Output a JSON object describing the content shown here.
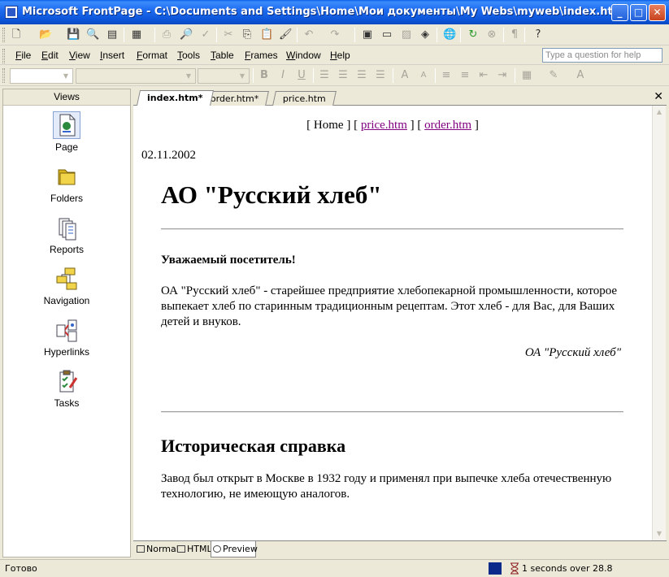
{
  "window": {
    "title": "Microsoft FrontPage - C:\\Documents and Settings\\Home\\Мои документы\\My Webs\\myweb\\index.htm",
    "minimize": "_",
    "maximize": "□",
    "close": "✕"
  },
  "menu": {
    "items": [
      {
        "key": "F",
        "rest": "ile"
      },
      {
        "key": "E",
        "rest": "dit"
      },
      {
        "key": "V",
        "rest": "iew"
      },
      {
        "key": "I",
        "rest": "nsert"
      },
      {
        "key": "F",
        "rest": "ormat"
      },
      {
        "key": "T",
        "rest": "ools"
      },
      {
        "key": "T",
        "rest": "able"
      },
      {
        "key": "F",
        "rest": "rames"
      },
      {
        "key": "W",
        "rest": "indow"
      },
      {
        "key": "H",
        "rest": "elp"
      }
    ],
    "help_placeholder": "Type a question for help"
  },
  "views": {
    "header": "Views",
    "items": [
      "Page",
      "Folders",
      "Reports",
      "Navigation",
      "Hyperlinks",
      "Tasks"
    ],
    "selected": "Page"
  },
  "tabs": [
    "index.htm*",
    "order.htm*",
    "price.htm"
  ],
  "tab_close": "✕",
  "page": {
    "nav": {
      "open1": "[ Home ] [ ",
      "link1": "price.htm",
      "mid": " ] [ ",
      "link2": "order.htm",
      "close": " ]"
    },
    "date": "02.11.2002",
    "h1": "АО \"Русский хлеб\"",
    "greeting": "Уважаемый  посетитель!",
    "intro": "ОА \"Русский  хлеб\" - старейшее предприятие хлебопекарной промышленности, которое выпекает хлеб по старинным традиционным рецептам. Этот хлеб - для Вас, для Ваших детей и внуков.",
    "signature": "ОА \"Русский хлеб\"",
    "h2": "Историческая справка",
    "history": "Завод был открыт в Москве в 1932 году и применял при выпечке хлеба отечественную технологию, не имеющую аналогов."
  },
  "modes": [
    "Normal",
    "HTML",
    "Preview"
  ],
  "active_mode": "Preview",
  "status": {
    "text": "Готово",
    "right": "1 seconds over 28.8"
  },
  "colors": {
    "link": "#800080",
    "titlebar": "#0b53d6"
  }
}
